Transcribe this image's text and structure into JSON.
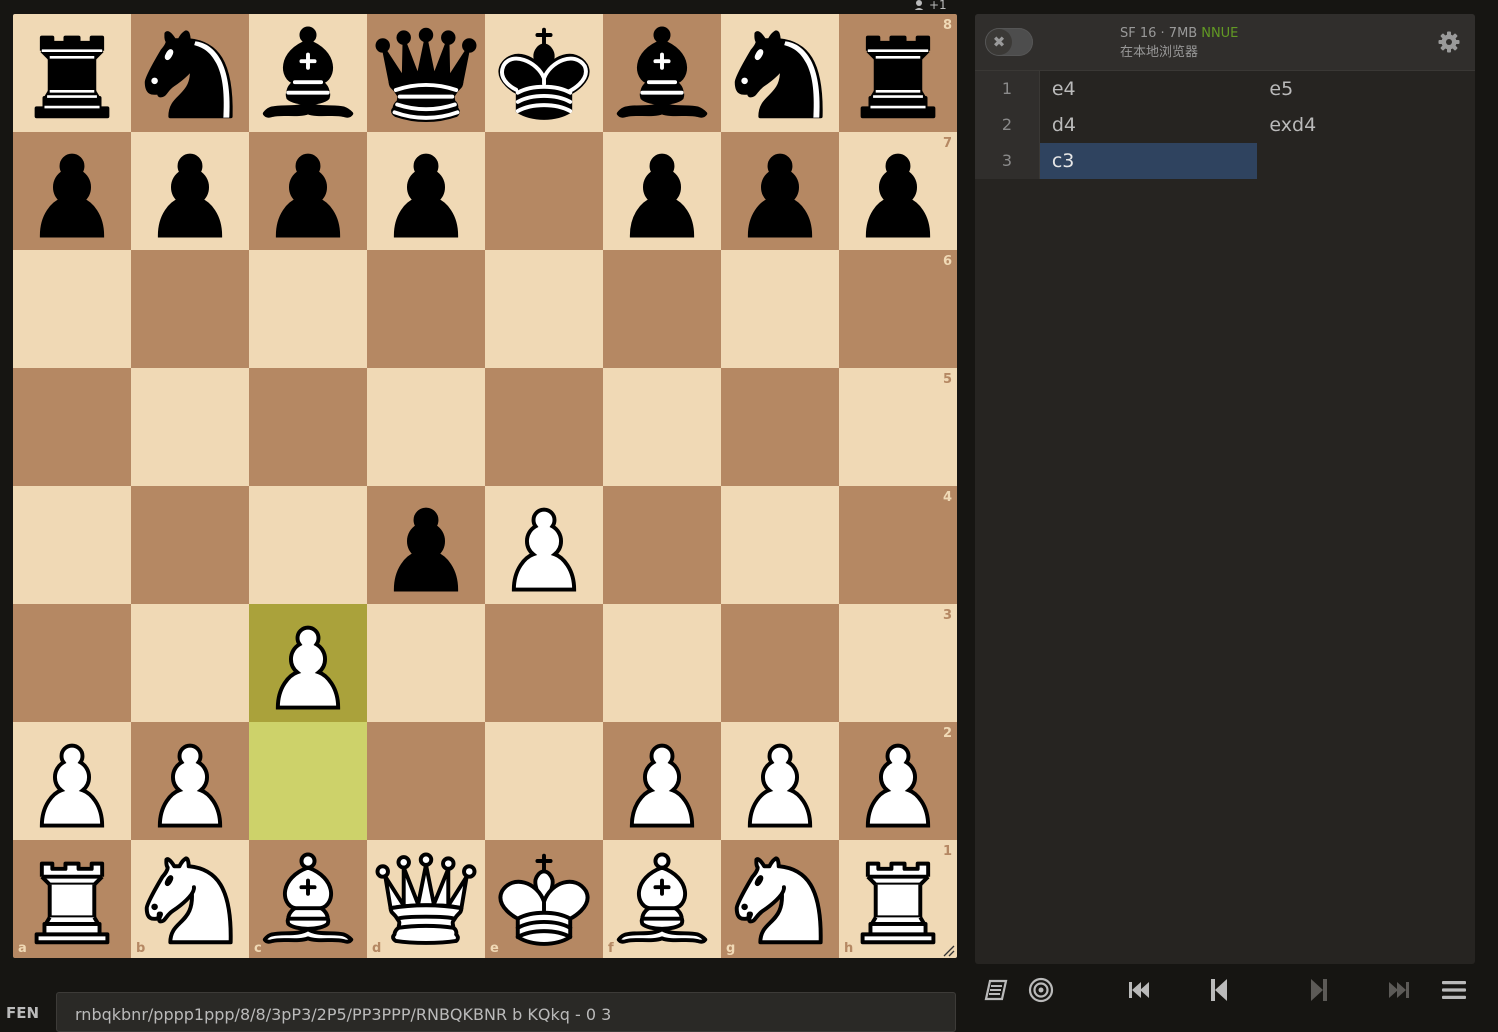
{
  "board": {
    "files": [
      "a",
      "b",
      "c",
      "d",
      "e",
      "f",
      "g",
      "h"
    ],
    "ranks": [
      "8",
      "7",
      "6",
      "5",
      "4",
      "3",
      "2",
      "1"
    ],
    "position": [
      [
        "bR",
        "bN",
        "bB",
        "bQ",
        "bK",
        "bB",
        "bN",
        "bR"
      ],
      [
        "bP",
        "bP",
        "bP",
        "bP",
        "",
        "bP",
        "bP",
        "bP"
      ],
      [
        "",
        "",
        "",
        "",
        "",
        "",
        "",
        ""
      ],
      [
        "",
        "",
        "",
        "",
        "",
        "",
        "",
        ""
      ],
      [
        "",
        "",
        "",
        "bP",
        "wP",
        "",
        "",
        ""
      ],
      [
        "",
        "",
        "wP",
        "",
        "",
        "",
        "",
        ""
      ],
      [
        "wP",
        "wP",
        "",
        "",
        "",
        "wP",
        "wP",
        "wP"
      ],
      [
        "wR",
        "wN",
        "wB",
        "wQ",
        "wK",
        "wB",
        "wN",
        "wR"
      ]
    ],
    "last_move": {
      "from": "c2",
      "to": "c3"
    },
    "light_color": "#f0d9b5",
    "dark_color": "#b58863",
    "highlight_from_color": "#cdd26a",
    "highlight_to_color": "#aaa23b"
  },
  "player_top": {
    "icon": "person-icon",
    "label": "+1"
  },
  "ceval": {
    "engine": "SF 16 · 7MB",
    "nnue": "NNUE",
    "subtitle": "在本地浏览器",
    "toggle_icon": "✖",
    "settings_icon": "gear-icon"
  },
  "moves": [
    {
      "n": "1",
      "white": "e4",
      "black": "e5"
    },
    {
      "n": "2",
      "white": "d4",
      "black": "exd4"
    },
    {
      "n": "3",
      "white": "c3",
      "black": ""
    }
  ],
  "active_move": "c3",
  "controls": [
    "book-icon",
    "target-icon",
    "first-icon",
    "prev-icon",
    "next-icon",
    "last-icon",
    "menu-icon"
  ],
  "fen": {
    "label": "FEN",
    "value": "rnbqkbnr/pppp1ppp/8/8/3pP3/2P5/PP3PPP/RNBQKBNR b KQkq - 0 3"
  }
}
